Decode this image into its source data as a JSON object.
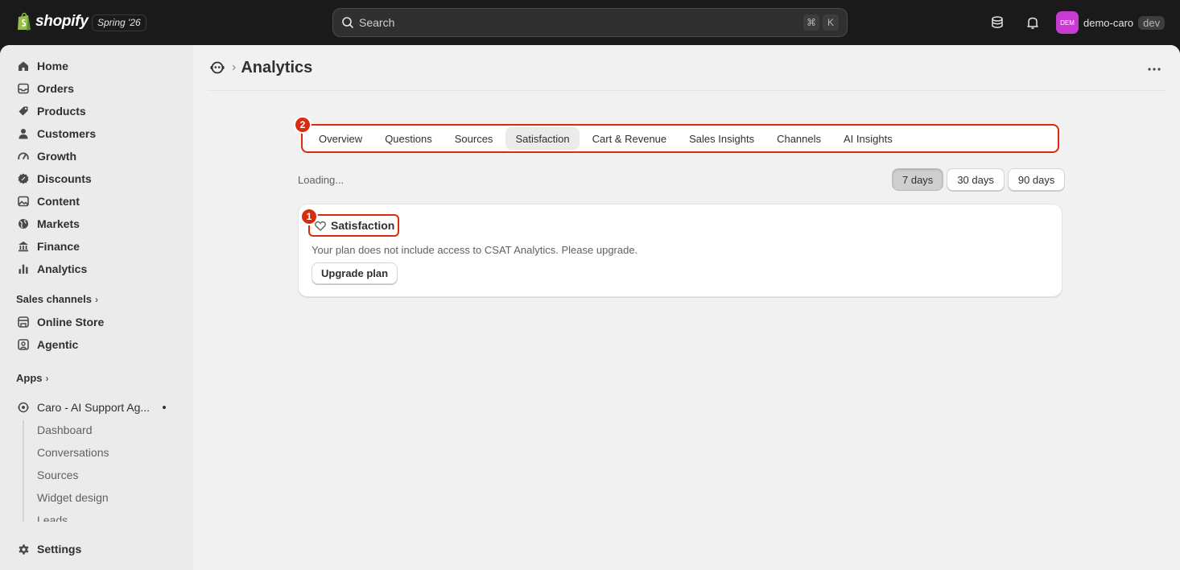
{
  "topbar": {
    "brand": "shopify",
    "edition": "Spring '26",
    "search_placeholder": "Search",
    "shortcut_cmd": "⌘",
    "shortcut_key": "K",
    "store_initials": "DEM",
    "store_name": "demo-caro",
    "store_badge": "dev"
  },
  "sidebar": {
    "items": [
      {
        "label": "Home",
        "icon": "home-icon"
      },
      {
        "label": "Orders",
        "icon": "inbox-icon"
      },
      {
        "label": "Products",
        "icon": "tag-icon"
      },
      {
        "label": "Customers",
        "icon": "person-icon"
      },
      {
        "label": "Growth",
        "icon": "gauge-icon"
      },
      {
        "label": "Discounts",
        "icon": "discount-icon"
      },
      {
        "label": "Content",
        "icon": "image-icon"
      },
      {
        "label": "Markets",
        "icon": "globe-icon"
      },
      {
        "label": "Finance",
        "icon": "bank-icon"
      },
      {
        "label": "Analytics",
        "icon": "bar-chart-icon"
      }
    ],
    "sales_channels_label": "Sales channels",
    "channels": [
      {
        "label": "Online Store",
        "icon": "store-icon"
      },
      {
        "label": "Agentic",
        "icon": "agent-icon"
      }
    ],
    "apps_label": "Apps",
    "app_name": "Caro - AI Support Ag...",
    "app_subitems": [
      "Dashboard",
      "Conversations",
      "Sources",
      "Widget design",
      "Leads"
    ],
    "settings_label": "Settings"
  },
  "page": {
    "title": "Analytics",
    "breadcrumb_sep": "›"
  },
  "tabs": [
    "Overview",
    "Questions",
    "Sources",
    "Satisfaction",
    "Cart & Revenue",
    "Sales Insights",
    "Channels",
    "AI Insights"
  ],
  "active_tab": "Satisfaction",
  "loading_text": "Loading...",
  "ranges": [
    "7 days",
    "30 days",
    "90 days"
  ],
  "active_range": "7 days",
  "card": {
    "title": "Satisfaction",
    "message": "Your plan does not include access to CSAT Analytics. Please upgrade.",
    "button": "Upgrade plan"
  },
  "annotations": [
    "1",
    "2"
  ],
  "colors": {
    "accent_red": "#d72c0d",
    "avatar": "#c93ad1",
    "topbar": "#1a1a1a"
  }
}
